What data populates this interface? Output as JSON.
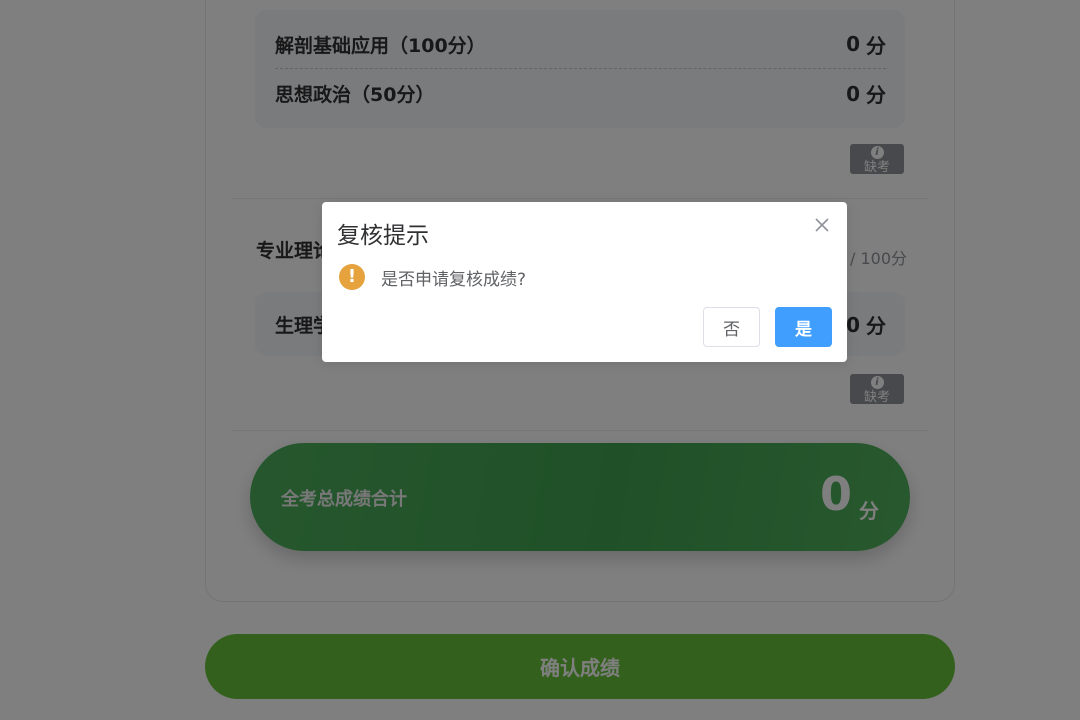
{
  "section1": {
    "subjects": [
      {
        "name": "解剖基础应用（100分）",
        "score": "0",
        "unit": "分"
      },
      {
        "name": "思想政治（50分）",
        "score": "0",
        "unit": "分"
      }
    ],
    "absent_label": "缺考",
    "absent_icon": "info-icon"
  },
  "section2": {
    "title": "专业理论",
    "max_score": "/ 100分",
    "subjects": [
      {
        "name": "生理学",
        "score": "0",
        "unit": "分"
      }
    ],
    "absent_label": "缺考",
    "absent_icon": "info-icon"
  },
  "total": {
    "label": "全考总成绩合计",
    "value": "0",
    "unit": "分"
  },
  "confirm_button": "确认成绩",
  "dialog": {
    "title": "复核提示",
    "message": "是否申请复核成绩?",
    "no_label": "否",
    "yes_label": "是",
    "close_icon": "close-icon",
    "warning_icon": "warning-icon"
  },
  "colors": {
    "primary": "#409eff",
    "success": "#67c23a",
    "warning": "#e6a23c",
    "tag_gray": "#909399"
  }
}
